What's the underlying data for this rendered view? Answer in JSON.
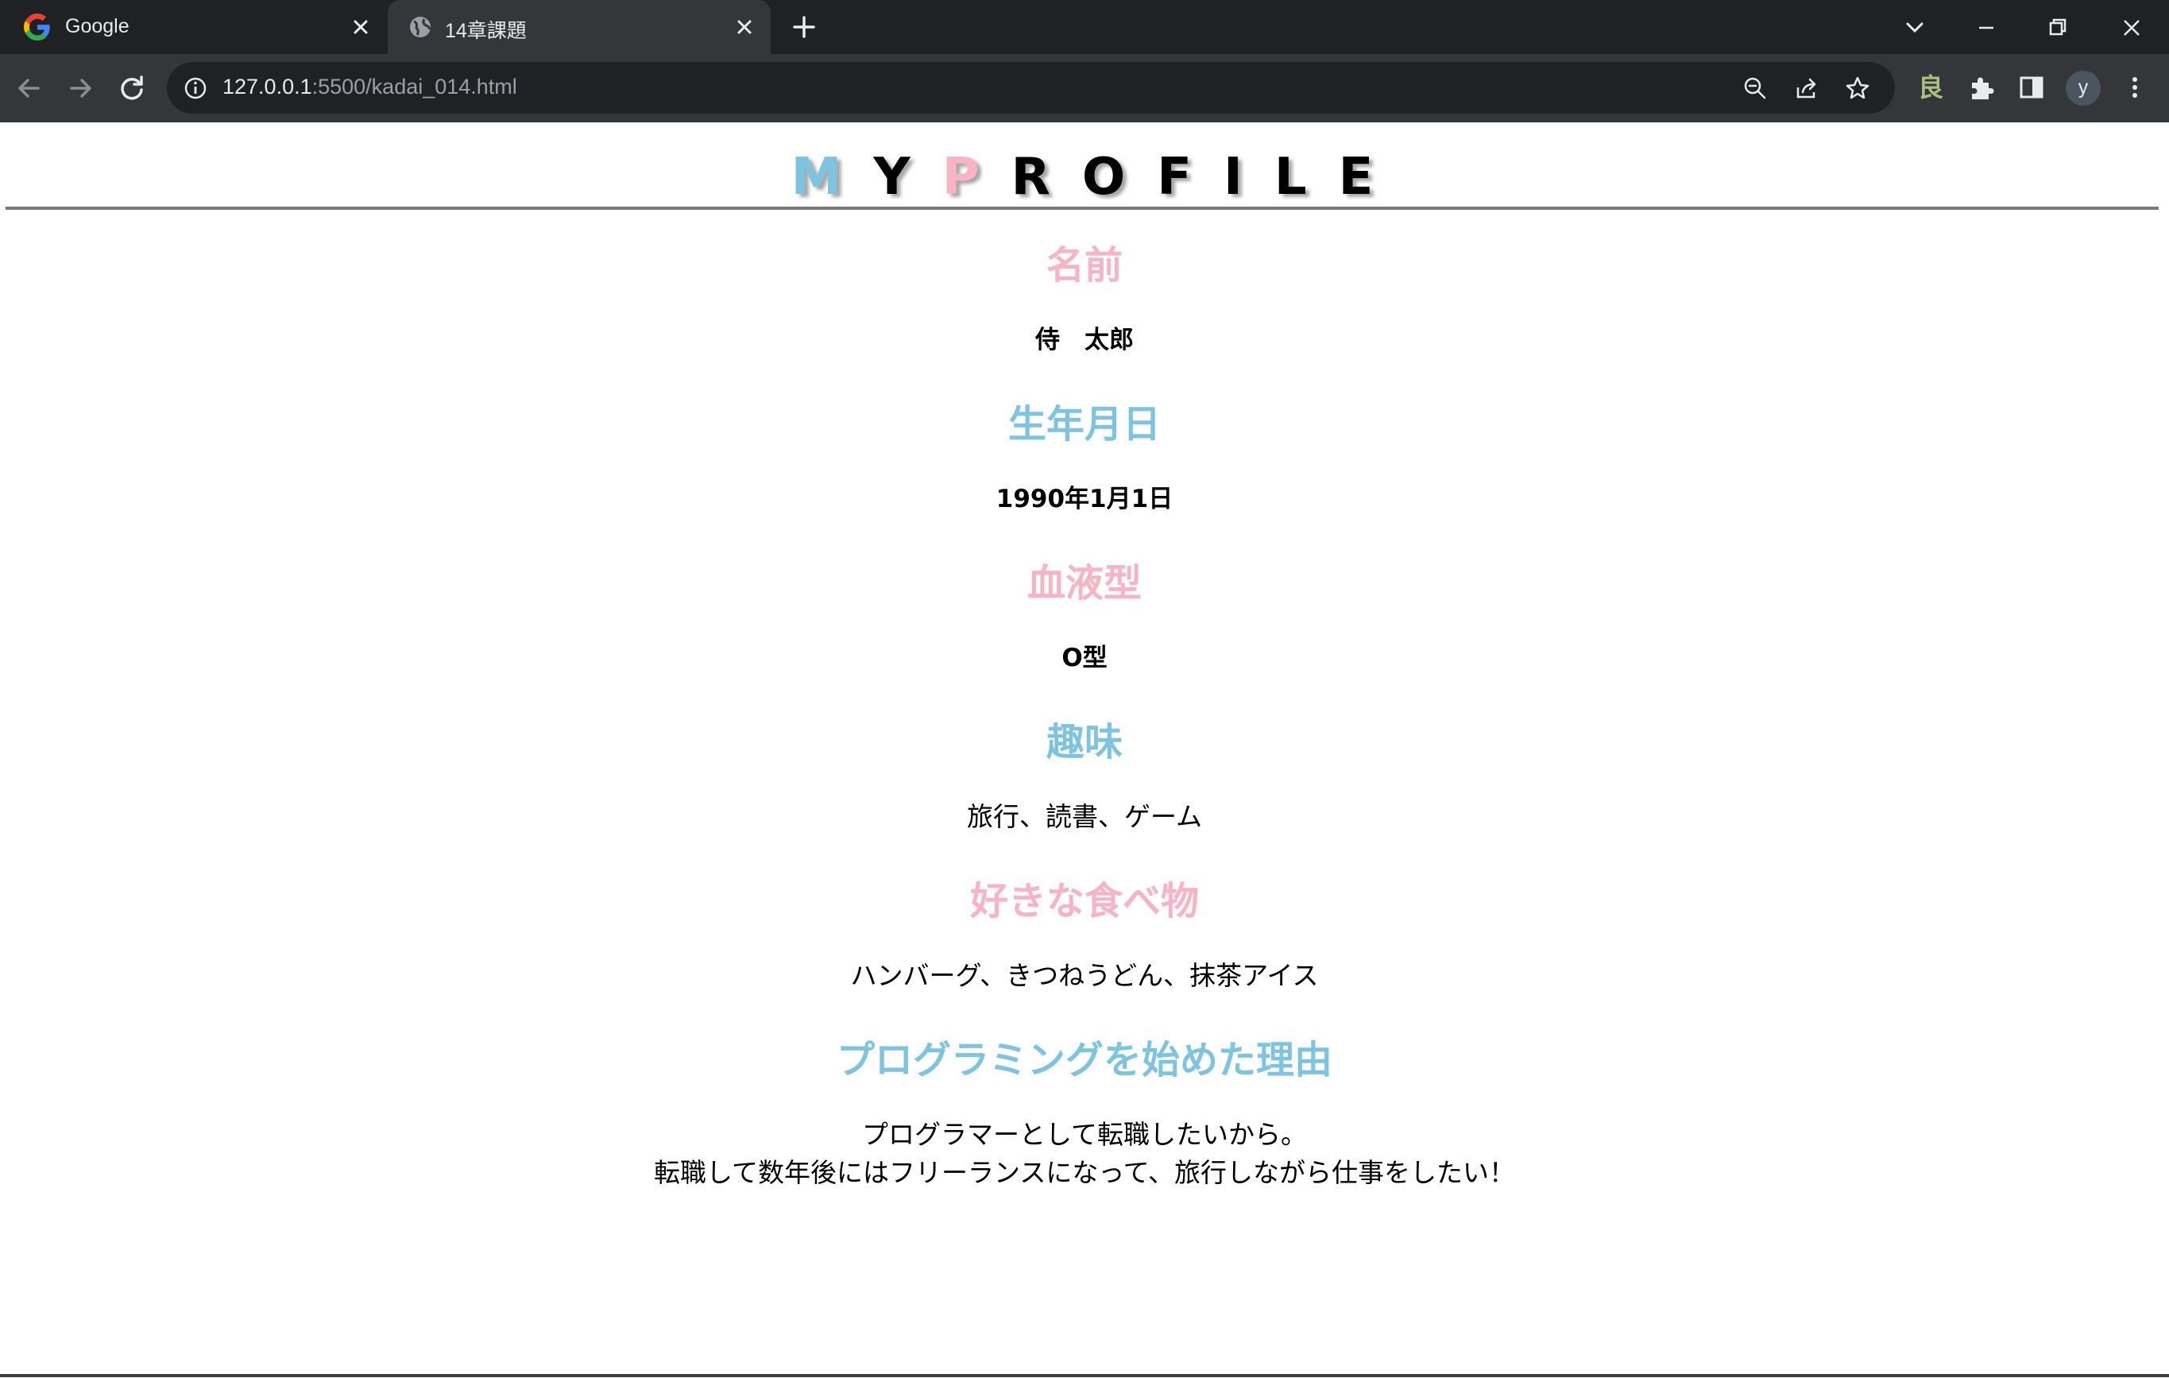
{
  "browser": {
    "tabs": [
      {
        "title": "Google",
        "favicon": "google-g-icon",
        "active": false
      },
      {
        "title": "14章課題",
        "favicon": "globe-icon",
        "active": true
      }
    ],
    "url_host": "127.0.0.1",
    "url_rest": ":5500/kadai_014.html",
    "extension_label": "良",
    "avatar_letter": "y"
  },
  "page": {
    "logo": {
      "first": "M",
      "second": "Y",
      "third": "P",
      "rest": "ROFILE",
      "accent_colors": {
        "m": "#7ec4e0",
        "p": "#f6b4c4"
      }
    },
    "sections": [
      {
        "heading": "名前",
        "value": "侍　太郎",
        "heading_color": "#f6b4c4"
      },
      {
        "heading": "生年月日",
        "value": "1990年1月1日",
        "heading_color": "#7ec4e0"
      },
      {
        "heading": "血液型",
        "value": "O型",
        "heading_color": "#f6b4c4"
      },
      {
        "heading": "趣味",
        "value": "旅行、読書、ゲーム",
        "heading_color": "#7ec4e0"
      },
      {
        "heading": "好きな食べ物",
        "value": "ハンバーグ、きつねうどん、抹茶アイス",
        "heading_color": "#f6b4c4"
      },
      {
        "heading": "プログラミングを始めた理由",
        "lines": [
          "プログラマーとして転職したいから。",
          "転職して数年後にはフリーランスになって、旅行しながら仕事をしたい！"
        ],
        "heading_color": "#7ec4e0"
      }
    ]
  }
}
